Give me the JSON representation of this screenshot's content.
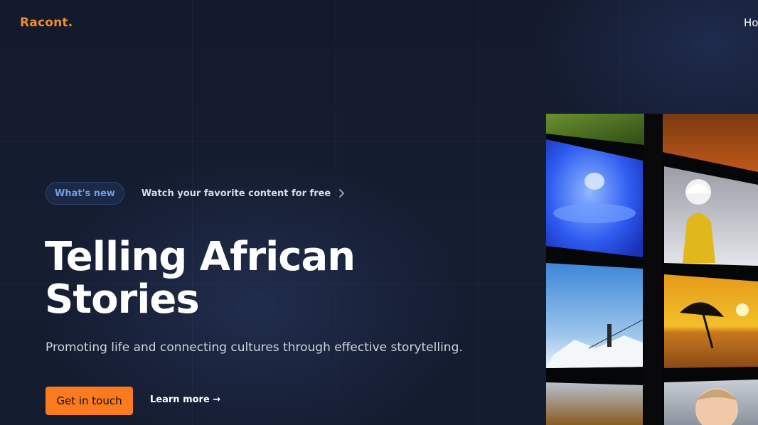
{
  "brand": {
    "logo_text": "Racont."
  },
  "nav": {
    "items": [
      {
        "label": "Ho"
      }
    ]
  },
  "announcement": {
    "badge": "What's new",
    "link_text": "Watch your favorite content for free",
    "chevron_icon": "chevron-right-icon"
  },
  "hero": {
    "title": "Telling African Stories",
    "subtitle": "Promoting life and connecting cultures through effective storytelling.",
    "primary_button": "Get in touch",
    "secondary_link": "Learn more →"
  },
  "colors": {
    "accent": "#f97a1f",
    "logo": "#f58a2e",
    "background": "#141b2e",
    "badge_text": "#6d9fe4"
  }
}
